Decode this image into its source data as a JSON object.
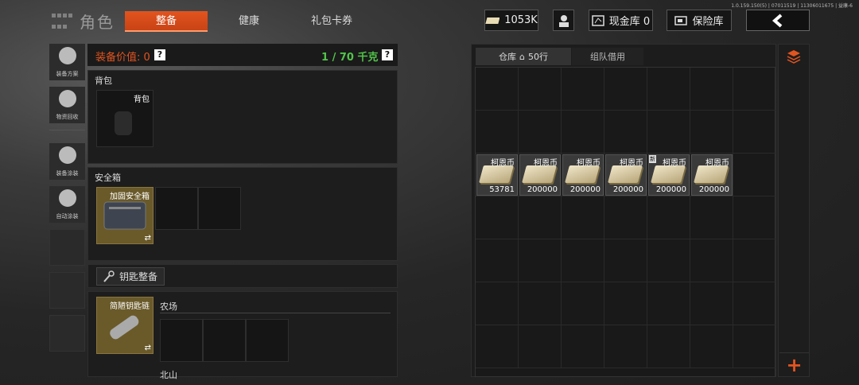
{
  "header": {
    "title": "角色",
    "tabs": [
      "整备",
      "健康",
      "礼包卡券"
    ],
    "active_tab": "整备",
    "version": "1.0.159.150(5) | 07011519 | 11306011675 | 益康-6",
    "currency": "1053K",
    "cash_label": "现金库 0",
    "safe_label": "保险库"
  },
  "nav": [
    "装备方案",
    "物资回收",
    "装备涂装",
    "自动涂装"
  ],
  "loadout": {
    "value_label": "装备价值: 0",
    "capacity": "1 / 70 千克",
    "backpack_section": "背包",
    "backpack_slot": "背包",
    "safebox_section": "安全箱",
    "safebox_item": "加固安全箱",
    "key_button": "钥匙整备",
    "key_item": "简陋钥匙链",
    "farm_label": "农场",
    "north_label": "北山"
  },
  "storage": {
    "tab_warehouse": "仓库",
    "rows": "50行",
    "tab_team": "组队借用"
  },
  "items": [
    {
      "name": "柯恩币",
      "count": "53781",
      "new": false
    },
    {
      "name": "柯恩币",
      "count": "200000",
      "new": false
    },
    {
      "name": "柯恩币",
      "count": "200000",
      "new": false
    },
    {
      "name": "柯恩币",
      "count": "200000",
      "new": false
    },
    {
      "name": "柯恩币",
      "count": "200000",
      "new": true
    },
    {
      "name": "柯恩币",
      "count": "200000",
      "new": false
    }
  ],
  "colors": {
    "accent": "#e2541f",
    "value": "#e2541f",
    "capacity": "#52c44a"
  }
}
